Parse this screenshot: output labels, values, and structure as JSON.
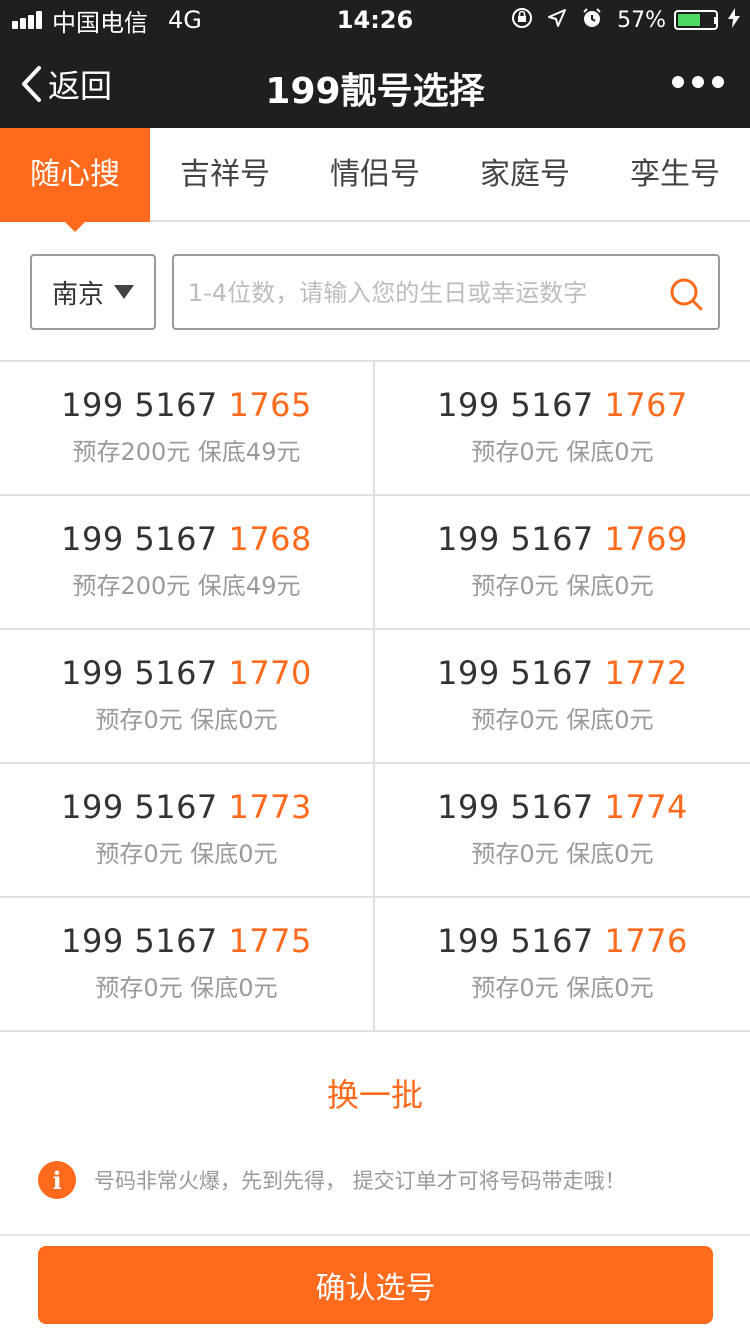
{
  "status_bar": {
    "carrier": "中国电信",
    "network": "4G",
    "time": "14:26",
    "battery_percent_text": "57%",
    "battery_level": 0.57
  },
  "nav": {
    "back_label": "返回",
    "title": "199靓号选择"
  },
  "tabs": [
    {
      "label": "随心搜",
      "active": true
    },
    {
      "label": "吉祥号",
      "active": false
    },
    {
      "label": "情侣号",
      "active": false
    },
    {
      "label": "家庭号",
      "active": false
    },
    {
      "label": "孪生号",
      "active": false
    }
  ],
  "search": {
    "city": "南京",
    "placeholder": "1-4位数，请输入您的生日或幸运数字"
  },
  "numbers": [
    {
      "prefix": "199 5167 ",
      "tail": "1765",
      "price": "预存200元 保底49元"
    },
    {
      "prefix": "199 5167 ",
      "tail": "1767",
      "price": "预存0元 保底0元"
    },
    {
      "prefix": "199 5167 ",
      "tail": "1768",
      "price": "预存200元 保底49元"
    },
    {
      "prefix": "199 5167 ",
      "tail": "1769",
      "price": "预存0元 保底0元"
    },
    {
      "prefix": "199 5167 ",
      "tail": "1770",
      "price": "预存0元 保底0元"
    },
    {
      "prefix": "199 5167 ",
      "tail": "1772",
      "price": "预存0元 保底0元"
    },
    {
      "prefix": "199 5167 ",
      "tail": "1773",
      "price": "预存0元 保底0元"
    },
    {
      "prefix": "199 5167 ",
      "tail": "1774",
      "price": "预存0元 保底0元"
    },
    {
      "prefix": "199 5167 ",
      "tail": "1775",
      "price": "预存0元 保底0元"
    },
    {
      "prefix": "199 5167 ",
      "tail": "1776",
      "price": "预存0元 保底0元"
    }
  ],
  "refresh_label": "换一批",
  "notice": "号码非常火爆，先到先得， 提交订单才可将号码带走哦！",
  "confirm_label": "确认选号",
  "colors": {
    "accent": "#ff6a1c",
    "bar": "#1f1f1f",
    "battery": "#4cd964"
  }
}
